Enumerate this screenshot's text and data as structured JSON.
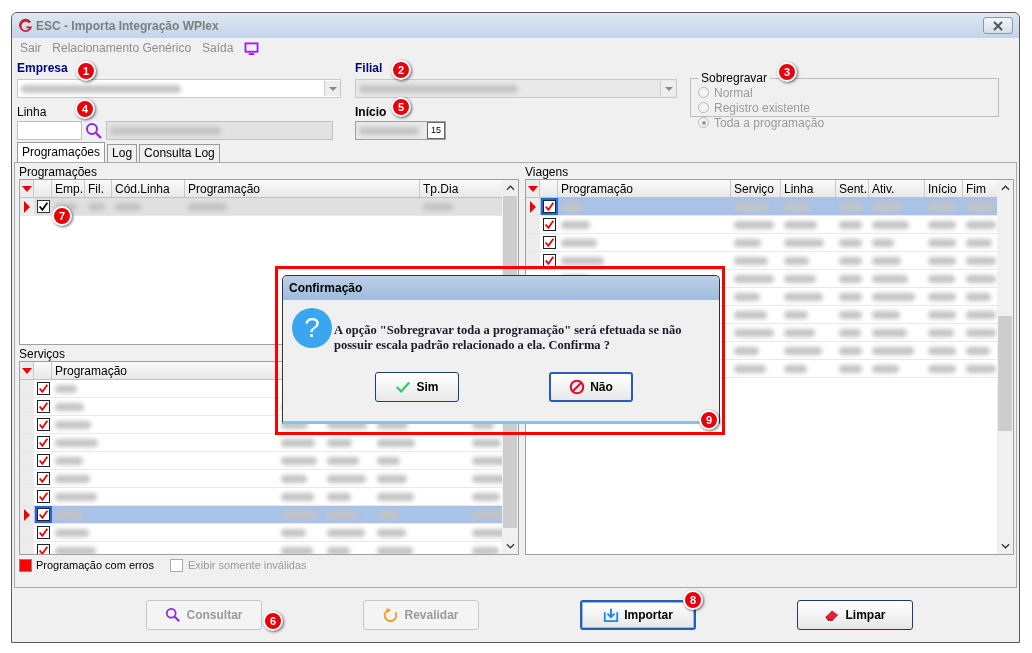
{
  "window": {
    "title": "ESC - Importa Integração WPlex"
  },
  "menu": [
    {
      "label": "Sair",
      "disabled": true
    },
    {
      "label": "Relacionamento Genérico",
      "disabled": true
    },
    {
      "label": "Saída",
      "disabled": true
    }
  ],
  "empresa": {
    "label": "Empresa",
    "disabled": false
  },
  "filial": {
    "label": "Filial",
    "disabled": true
  },
  "linha": {
    "label": "Linha"
  },
  "inicio": {
    "label": "Início",
    "calendar_label": "15"
  },
  "sobregravar": {
    "title": "Sobregravar",
    "options": [
      {
        "label": "Normal",
        "selected": false,
        "disabled": true
      },
      {
        "label": "Registro existente",
        "selected": false,
        "disabled": true
      },
      {
        "label": "Toda a programação",
        "selected": true,
        "disabled": true
      }
    ]
  },
  "tabs": [
    {
      "label": "Programações",
      "selected": true
    },
    {
      "label": "Log",
      "selected": false
    },
    {
      "label": "Consulta Log",
      "selected": false
    }
  ],
  "programacoes": {
    "label": "Programações",
    "columns": [
      "Emp.",
      "Fil.",
      "Cód.Linha",
      "Programação",
      "Tp.Dia"
    ],
    "rows": [
      {
        "current": true,
        "checked": true,
        "selected": true
      }
    ]
  },
  "servicos": {
    "label": "Serviços",
    "columns": [
      "Programação"
    ],
    "rows": [
      {
        "current": false,
        "checked": true,
        "selected": false
      },
      {
        "current": false,
        "checked": true,
        "selected": false
      },
      {
        "current": false,
        "checked": true,
        "selected": false
      },
      {
        "current": false,
        "checked": true,
        "selected": false
      },
      {
        "current": false,
        "checked": true,
        "selected": false
      },
      {
        "current": false,
        "checked": true,
        "selected": false
      },
      {
        "current": false,
        "checked": true,
        "selected": false
      },
      {
        "current": true,
        "checked": true,
        "selected": true
      },
      {
        "current": false,
        "checked": true,
        "selected": false
      },
      {
        "current": false,
        "checked": true,
        "selected": false
      }
    ]
  },
  "viagens": {
    "label": "Viagens",
    "columns": [
      "Programação",
      "Serviço",
      "Linha",
      "Sent.",
      "Ativ.",
      "Início",
      "Fim"
    ],
    "rows": [
      {
        "current": true,
        "checked": true,
        "selected": true
      },
      {
        "current": false,
        "checked": true,
        "selected": false
      },
      {
        "current": false,
        "checked": true,
        "selected": false
      },
      {
        "current": false,
        "checked": true,
        "selected": false
      },
      {
        "selected": false
      },
      {
        "selected": false
      },
      {
        "selected": false
      },
      {
        "selected": false
      },
      {
        "selected": false
      },
      {
        "selected": false
      }
    ]
  },
  "legend": {
    "label": "Programação com erros",
    "color": "#ff0000"
  },
  "exibir_invalidas": {
    "label": "Exibir somente inválidas",
    "checked": false,
    "disabled": true
  },
  "buttons": [
    {
      "kind": "search",
      "label": "Consultar",
      "disabled": true,
      "default": false
    },
    {
      "kind": "refresh",
      "label": "Revalidar",
      "disabled": true,
      "default": false
    },
    {
      "kind": "import",
      "label": "Importar",
      "disabled": false,
      "default": true
    },
    {
      "kind": "eraser",
      "label": "Limpar",
      "disabled": false,
      "default": false
    }
  ],
  "dialog": {
    "title": "Confirmação",
    "icon_glyph": "?",
    "message": "A opção \"Sobregravar toda a programação\" será efetuada se não possuir escala padrão relacionado a ela. Confirma ?",
    "buttons": [
      {
        "kind": "yes",
        "label": "Sim"
      },
      {
        "kind": "no",
        "label": "Não"
      }
    ]
  },
  "callouts": [
    "1",
    "2",
    "3",
    "4",
    "5",
    "6",
    "7",
    "8",
    "9"
  ]
}
